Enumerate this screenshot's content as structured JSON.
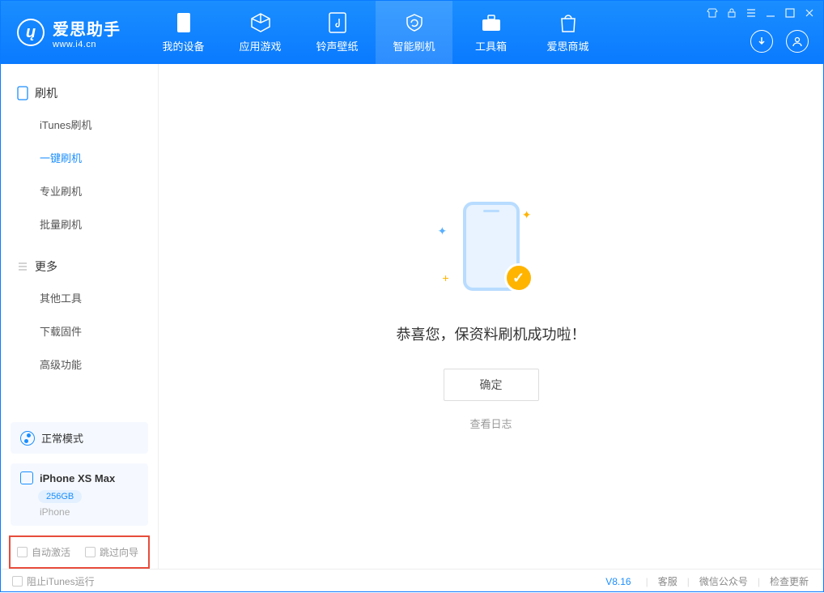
{
  "app": {
    "title": "爱思助手",
    "subtitle": "www.i4.cn"
  },
  "tabs": [
    {
      "label": "我的设备"
    },
    {
      "label": "应用游戏"
    },
    {
      "label": "铃声壁纸"
    },
    {
      "label": "智能刷机"
    },
    {
      "label": "工具箱"
    },
    {
      "label": "爱思商城"
    }
  ],
  "sidebar": {
    "group1_title": "刷机",
    "items1": [
      "iTunes刷机",
      "一键刷机",
      "专业刷机",
      "批量刷机"
    ],
    "group2_title": "更多",
    "items2": [
      "其他工具",
      "下载固件",
      "高级功能"
    ]
  },
  "mode": {
    "label": "正常模式"
  },
  "device": {
    "name": "iPhone XS Max",
    "storage": "256GB",
    "type": "iPhone"
  },
  "options": {
    "auto_activate": "自动激活",
    "skip_guide": "跳过向导"
  },
  "main": {
    "success_text": "恭喜您，保资料刷机成功啦！",
    "ok_button": "确定",
    "view_log": "查看日志"
  },
  "footer": {
    "block_itunes": "阻止iTunes运行",
    "version": "V8.16",
    "service": "客服",
    "wechat": "微信公众号",
    "update": "检查更新"
  }
}
